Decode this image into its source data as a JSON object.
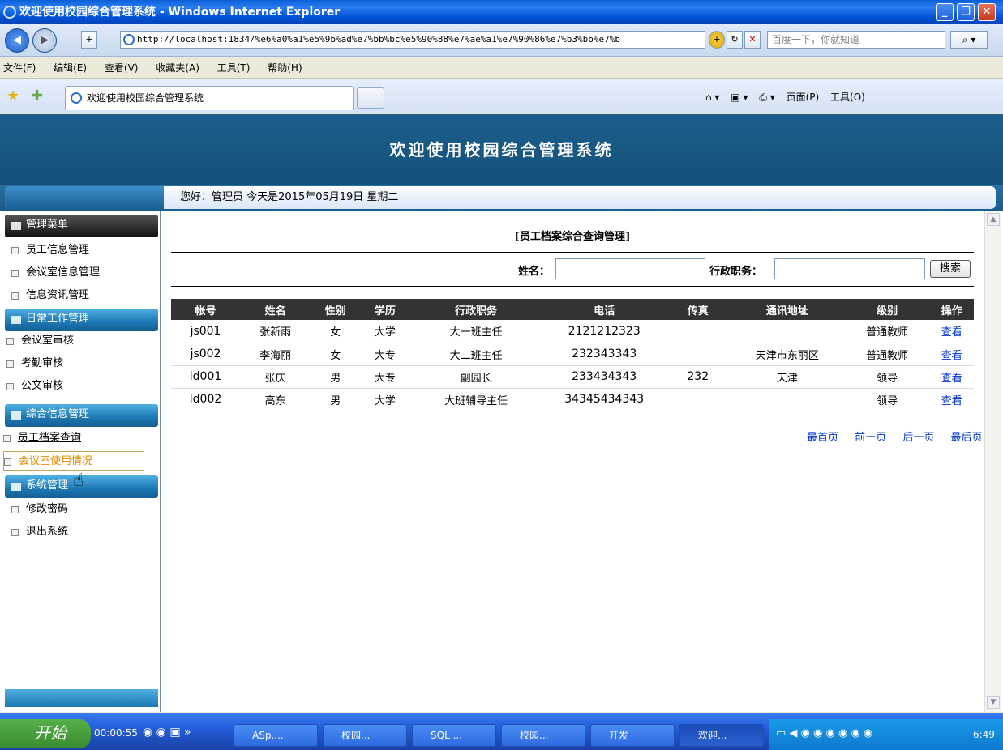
{
  "window": {
    "title": "欢迎使用校园综合管理系统 - Windows Internet Explorer",
    "url": "http://localhost:1834/%e6%a0%a1%e5%9b%ad%e7%bb%bc%e5%90%88%e7%ae%a1%e7%90%86%e7%b3%bb%e7%b",
    "search_placeholder": "百度一下，你就知道",
    "menu": [
      "文件(F)",
      "编辑(E)",
      "查看(V)",
      "收藏夹(A)",
      "工具(T)",
      "帮助(H)"
    ],
    "tab_title": "欢迎使用校园综合管理系统",
    "cmd": {
      "page": "页面(P)",
      "tools": "工具(O)"
    }
  },
  "site": {
    "banner": "欢迎使用校园综合管理系统",
    "greeting": "您好：管理员   今天是2015年05月19日   星期二"
  },
  "sidebar": {
    "sections": [
      {
        "title": "管理菜单",
        "items": [
          "员工信息管理",
          "会议室信息管理",
          "信息资讯管理"
        ]
      },
      {
        "title": "日常工作管理",
        "items": [
          "会议室审核",
          "考勤审核",
          "公文审核"
        ]
      },
      {
        "title": "综合信息管理",
        "items": [
          "员工档案查询",
          "会议室使用情况"
        ]
      },
      {
        "title": "系统管理",
        "items": [
          "修改密码",
          "退出系统"
        ]
      }
    ]
  },
  "main": {
    "title": "[员工档案综合查询管理]",
    "name_label": "姓名：",
    "post_label": "行政职务：",
    "search_button": "搜索",
    "columns": [
      "帐号",
      "姓名",
      "性别",
      "学历",
      "行政职务",
      "电话",
      "传真",
      "通讯地址",
      "级别",
      "操作"
    ],
    "rows": [
      [
        "js001",
        "张新雨",
        "女",
        "大学",
        "大一班主任",
        "2121212323",
        "",
        "",
        "普通教师",
        "查看"
      ],
      [
        "js002",
        "李海丽",
        "女",
        "大专",
        "大二班主任",
        "232343343",
        "",
        "天津市东丽区",
        "普通教师",
        "查看"
      ],
      [
        "ld001",
        "张庆",
        "男",
        "大专",
        "副园长",
        "233434343",
        "232",
        "天津",
        "领导",
        "查看"
      ],
      [
        "ld002",
        "高东",
        "男",
        "大学",
        "大班辅导主任",
        "34345434343",
        "",
        "",
        "领导",
        "查看"
      ]
    ],
    "pager": [
      "最首页",
      "前一页",
      "后一页",
      "最后页"
    ]
  },
  "taskbar": {
    "start": "开始",
    "timer": "00:00:55",
    "buttons": [
      "ASp....",
      "校园...",
      "SQL ...",
      "校园...",
      "开发",
      "欢迎..."
    ],
    "clock": "6:49"
  }
}
